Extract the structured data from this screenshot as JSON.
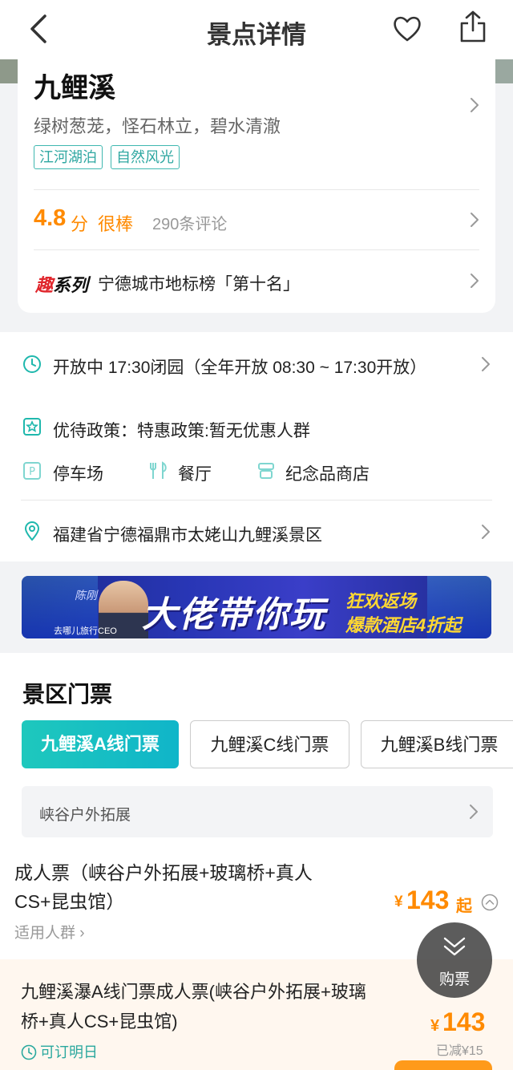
{
  "header": {
    "title": "景点详情"
  },
  "poi": {
    "name": "九鲤溪",
    "description": "绿树葱茏，怪石林立，碧水清澈",
    "tags": [
      "江河湖泊",
      "自然风光"
    ],
    "rating": {
      "score": "4.8",
      "unit": "分",
      "word": "很棒",
      "count": "290条评论"
    },
    "ranking": {
      "logo_first": "趣",
      "logo_rest": "系列",
      "text": "宁德城市地标榜「第十名」"
    }
  },
  "info": {
    "hours": "开放中 17:30闭园（全年开放 08:30 ~ 17:30开放）",
    "policy": "优待政策：特惠政策:暂无优惠人群",
    "facilities": [
      "停车场",
      "餐厅",
      "纪念品商店"
    ],
    "address": "福建省宁德福鼎市太姥山九鲤溪景区"
  },
  "banner": {
    "signature": "陈刚",
    "subtitle": "去哪儿旅行CEO",
    "headline": "大佬带你玩",
    "line1": "狂欢返场",
    "line2": "爆款酒店4折起"
  },
  "tickets": {
    "section_title": "景区门票",
    "tabs": [
      "九鲤溪A线门票",
      "九鲤溪C线门票",
      "九鲤溪B线门票"
    ],
    "sub_category": "峡谷户外拓展",
    "item": {
      "name": "成人票（峡谷户外拓展+玻璃桥+真人CS+昆虫馆）",
      "crowd": "适用人群",
      "currency": "¥",
      "price": "143",
      "price_suffix": "起"
    }
  },
  "bottom_bar": {
    "name": "九鲤溪瀑A线门票成人票(峡谷户外拓展+玻璃桥+真人CS+昆虫馆)",
    "availability": "可订明日",
    "currency": "¥",
    "price": "143",
    "discount": "已减¥15"
  },
  "float_button": {
    "label": "购票"
  },
  "colors": {
    "accent": "#ff8a00",
    "teal": "#1ec8bd",
    "tag": "#2ea7a1"
  }
}
